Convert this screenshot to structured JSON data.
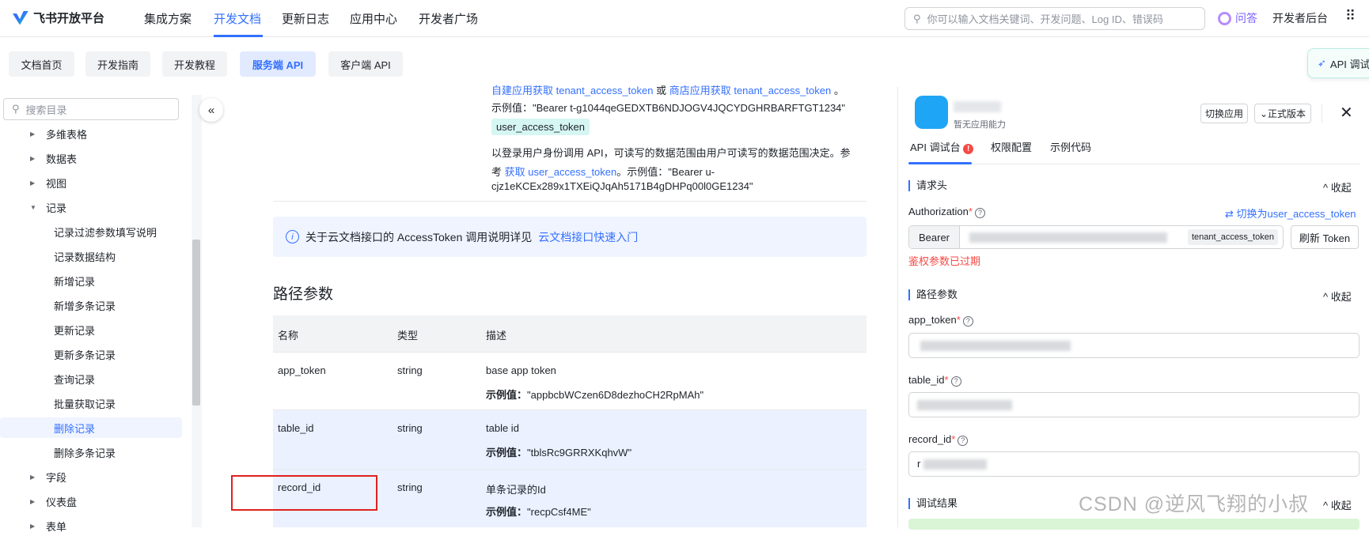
{
  "topnav": {
    "brand": "飞书开放平台",
    "items": [
      "集成方案",
      "开发文档",
      "更新日志",
      "应用中心",
      "开发者广场"
    ],
    "active": "开发文档",
    "search_placeholder": "你可以输入文档关键词、开发问题、Log ID、错误码",
    "qa": "问答",
    "console": "开发者后台"
  },
  "subnav": {
    "tabs": [
      "文档首页",
      "开发指南",
      "开发教程",
      "服务端 API",
      "客户端 API"
    ],
    "active": "服务端 API"
  },
  "sidebar": {
    "search_placeholder": "搜索目录",
    "items": [
      {
        "label": "多维表格",
        "level": 0,
        "arrow": "▶"
      },
      {
        "label": "数据表",
        "level": 0,
        "arrow": "▶"
      },
      {
        "label": "视图",
        "level": 0,
        "arrow": "▶"
      },
      {
        "label": "记录",
        "level": 0,
        "arrow": "▼"
      },
      {
        "label": "记录过滤参数填写说明",
        "level": 1
      },
      {
        "label": "记录数据结构",
        "level": 1
      },
      {
        "label": "新增记录",
        "level": 1
      },
      {
        "label": "新增多条记录",
        "level": 1
      },
      {
        "label": "更新记录",
        "level": 1
      },
      {
        "label": "更新多条记录",
        "level": 1
      },
      {
        "label": "查询记录",
        "level": 1
      },
      {
        "label": "批量获取记录",
        "level": 1
      },
      {
        "label": "删除记录",
        "level": 1,
        "selected": true
      },
      {
        "label": "删除多条记录",
        "level": 1
      },
      {
        "label": "字段",
        "level": 0,
        "arrow": "▶"
      },
      {
        "label": "仪表盘",
        "level": 0,
        "arrow": "▶"
      },
      {
        "label": "表单",
        "level": 0,
        "arrow": "▶"
      }
    ]
  },
  "doc": {
    "line1_link1": "自建应用获取 tenant_access_token",
    "line1_or": " 或 ",
    "line1_link2": "商店应用获取 tenant_access_token",
    "line1_end": " 。",
    "line2": "示例值：\"Bearer t-g1044qeGEDXTB6NDJOGV4JQCYDGHRBARFTGT1234\"",
    "tag": "user_access_token",
    "line3": "以登录用户身份调用 API，可读写的数据范围由用户可读写的数据范围决定。参",
    "line4_pre": "考 ",
    "line4_link": "获取 user_access_token",
    "line4_post": "。示例值：\"Bearer u-",
    "line5": "cjz1eKCEx289x1TXEiQJqAh5171B4gDHPq00l0GE1234\"",
    "info_icon": "i",
    "info_text": "关于云文档接口的 AccessToken 调用说明详见",
    "info_link": "云文档接口快速入门",
    "section_title": "路径参数",
    "table": {
      "headers": [
        "名称",
        "类型",
        "描述"
      ],
      "example_label": "示例值：",
      "rows": [
        {
          "name": "app_token",
          "type": "string",
          "desc": "base app token",
          "example": "\"appbcbWCzen6D8dezhoCH2RpMAh\""
        },
        {
          "name": "table_id",
          "type": "string",
          "desc": "table id",
          "example": "\"tblsRc9GRRXKqhvW\""
        },
        {
          "name": "record_id",
          "type": "string",
          "desc": "单条记录的Id",
          "example": "\"recpCsf4ME\""
        }
      ]
    }
  },
  "panel": {
    "float_button": "API 调试",
    "app_subtitle": "暂无应用能力",
    "switch_app": "切换应用",
    "version": "正式版本",
    "tabs": [
      "API 调试台",
      "权限配置",
      "示例代码"
    ],
    "header_section": "请求头",
    "collapse": "收起",
    "auth_label": "Authorization",
    "switch_token": "切换为user_access_token",
    "bearer": "Bearer",
    "token_tag": "tenant_access_token",
    "refresh": "刷新 Token",
    "auth_error": "鉴权参数已过期",
    "path_section": "路径参数",
    "fields": [
      "app_token",
      "table_id",
      "record_id"
    ],
    "record_prefix": "r",
    "result_section": "调试结果"
  },
  "watermark": "CSDN @逆风飞翔的小叔",
  "colors": {
    "accent": "#3370ff",
    "error": "#f54a45",
    "highlight": "#e02020"
  }
}
